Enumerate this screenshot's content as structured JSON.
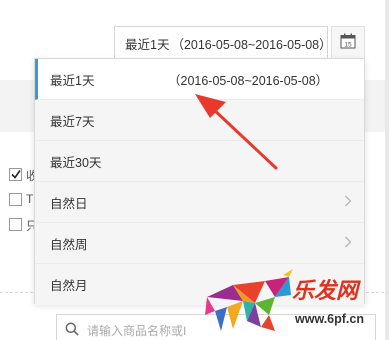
{
  "date_picker": {
    "selected_label": "最近1天",
    "selected_range": "（2016-05-08~2016-05-08）",
    "calendar_icon": "calendar-icon",
    "calendar_day": "15"
  },
  "menu": {
    "items": [
      {
        "label": "最近1天",
        "range": "（2016-05-08~2016-05-08）",
        "active": true
      },
      {
        "label": "最近7天"
      },
      {
        "label": "最近30天"
      },
      {
        "label": "自然日",
        "has_submenu": true
      },
      {
        "label": "自然周",
        "has_submenu": true
      },
      {
        "label": "自然月"
      }
    ]
  },
  "checkboxes": [
    {
      "text": "收",
      "checked": true
    },
    {
      "text": "T",
      "checked": false
    },
    {
      "text": "只",
      "checked": false
    }
  ],
  "search": {
    "placeholder": "请输入商品名称或I",
    "icon": "search-icon"
  },
  "watermark": {
    "brand": "乐发网",
    "url": "www.6pf.cn"
  },
  "colors": {
    "accent": "#3a9ad9",
    "annotation": "#e8392c",
    "brand": "#e0301e"
  }
}
